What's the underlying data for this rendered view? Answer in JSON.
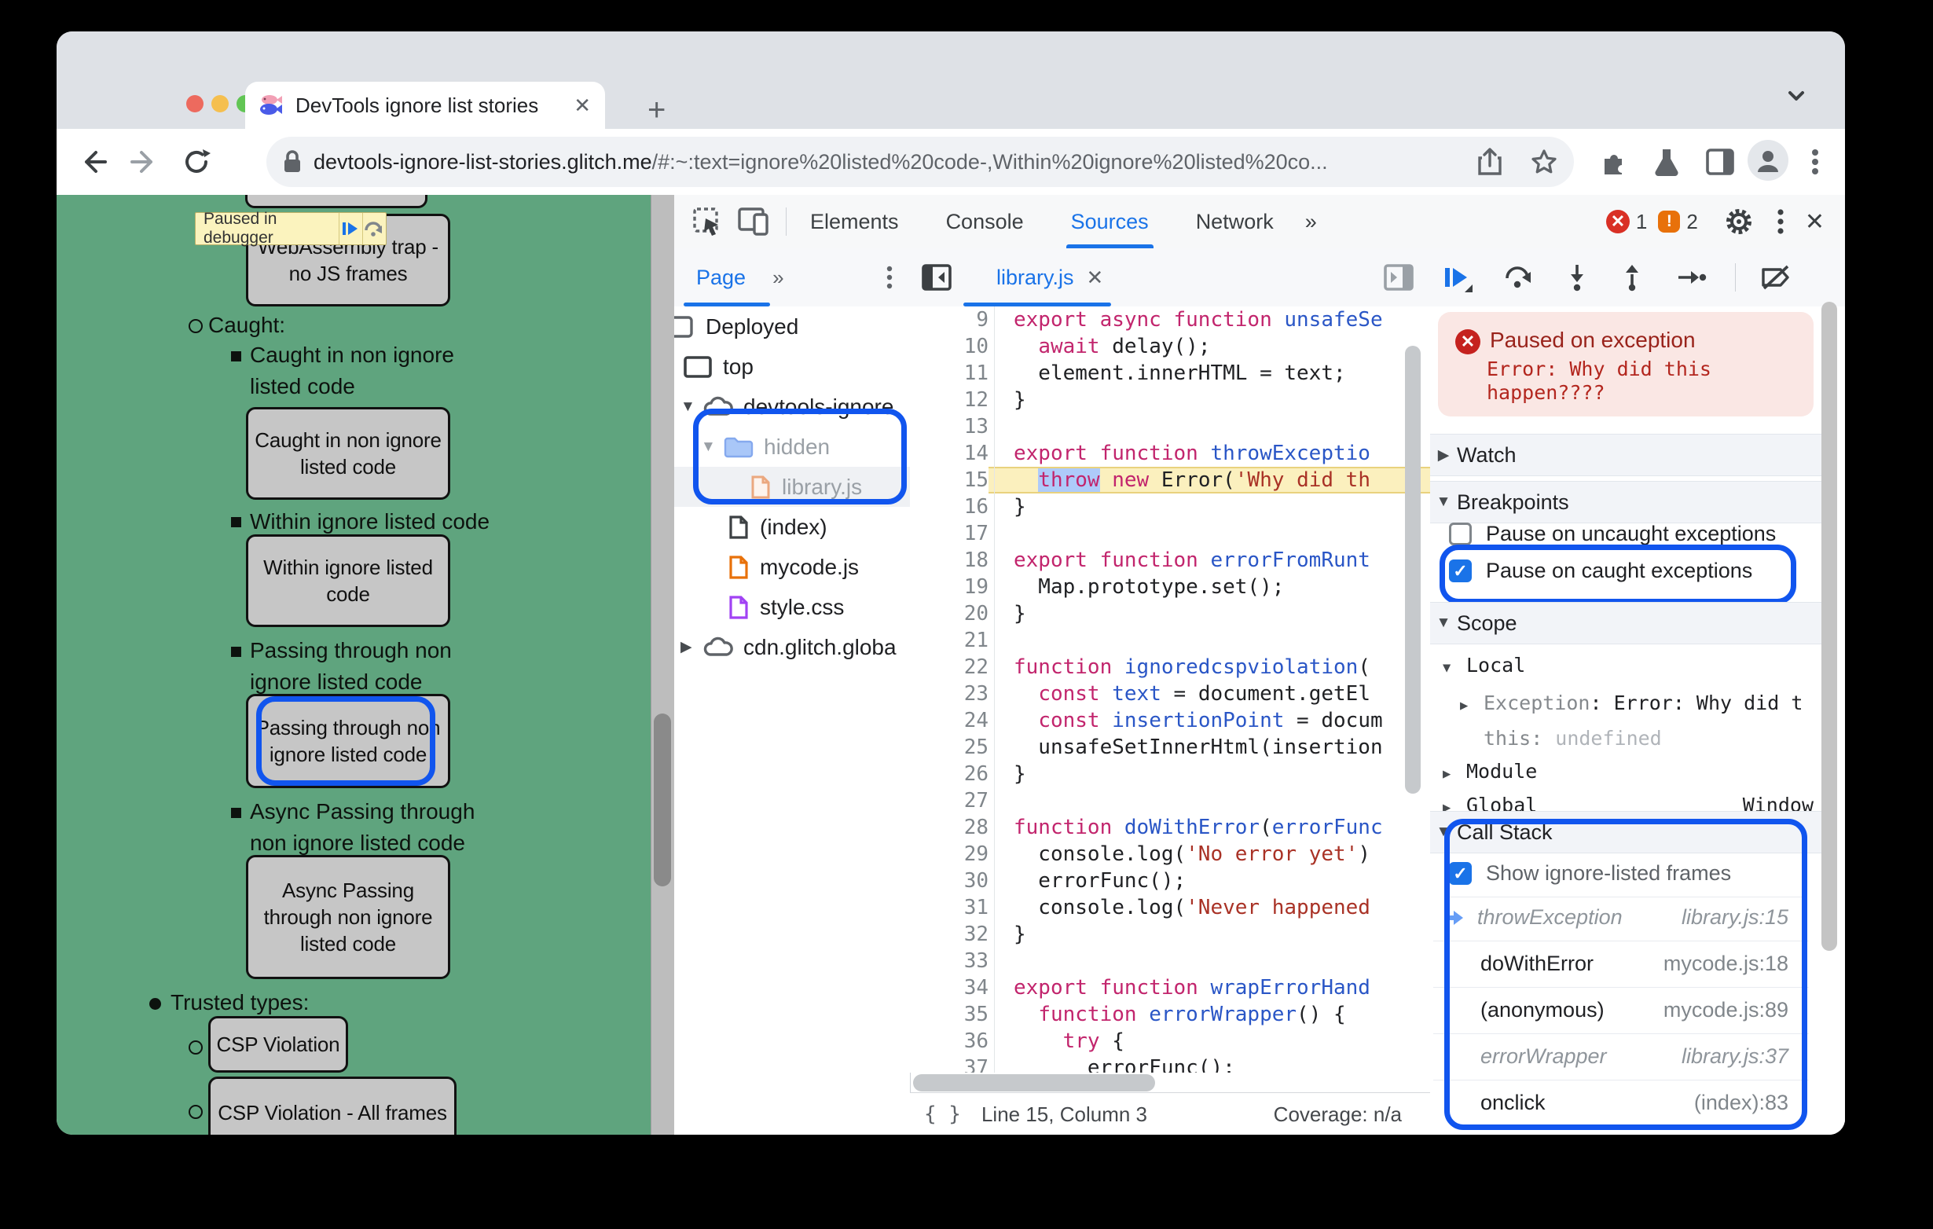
{
  "colors": {
    "accent": "#1A73E8",
    "annotation": "#1155EE",
    "page_green": "#5FA47E",
    "paused_line": "#FBF0BE",
    "error_red": "#C5221F"
  },
  "window": {
    "tab_title": "DevTools ignore list stories",
    "url_domain": "devtools-ignore-list-stories.glitch.me",
    "url_path": "/#:~:text=ignore%20listed%20code-,Within%20ignore%20listed%20co..."
  },
  "page": {
    "debugger_banner": "Paused in debugger",
    "wasm_button": "WebAssembly trap - no JS frames",
    "caught_label": "Caught:",
    "caught_item": "Caught in non ignore listed code",
    "caught_button": "Caught in non ignore listed code",
    "within_item": "Within ignore listed code",
    "within_button": "Within ignore listed code",
    "passing_item": "Passing through non ignore listed code",
    "passing_button": "Passing through non ignore listed code",
    "async_item": "Async Passing through non ignore listed code",
    "async_button": "Async Passing through non ignore listed code",
    "trusted_label": "Trusted types:",
    "csp_button": "CSP Violation",
    "csp_frames_button": "CSP Violation - All frames"
  },
  "devtools": {
    "tabs": {
      "elements": "Elements",
      "console": "Console",
      "sources": "Sources",
      "network": "Network",
      "more": "»"
    },
    "error_count": "1",
    "warning_count": "2",
    "navigator": {
      "tab_label": "Page",
      "more": "»",
      "tree": [
        {
          "label": "Deployed"
        },
        {
          "label": "top"
        },
        {
          "label": "devtools-ignore"
        },
        {
          "label": "hidden"
        },
        {
          "label": "library.js"
        },
        {
          "label": "(index)"
        },
        {
          "label": "mycode.js"
        },
        {
          "label": "style.css"
        },
        {
          "label": "cdn.glitch.globa"
        }
      ]
    },
    "editor": {
      "tab_label": "library.js",
      "status_line": "Line 15, Column 3",
      "status_coverage": "Coverage: n/a",
      "lines": [
        {
          "n": "9",
          "tokens": [
            [
              "k",
              "export async function "
            ],
            [
              "f",
              "unsafeSe"
            ]
          ]
        },
        {
          "n": "10",
          "tokens": [
            [
              "d",
              "  "
            ],
            [
              "k",
              "await"
            ],
            [
              "d",
              " delay();"
            ]
          ]
        },
        {
          "n": "11",
          "tokens": [
            [
              "d",
              "  element.innerHTML = text;"
            ]
          ]
        },
        {
          "n": "12",
          "tokens": [
            [
              "d",
              "}"
            ]
          ]
        },
        {
          "n": "13",
          "tokens": []
        },
        {
          "n": "14",
          "tokens": [
            [
              "k",
              "export function "
            ],
            [
              "f",
              "throwExceptio"
            ]
          ]
        },
        {
          "n": "15",
          "hl": true,
          "tokens": [
            [
              "d",
              "  "
            ],
            [
              "k sel",
              "throw"
            ],
            [
              "d",
              " "
            ],
            [
              "k",
              "new"
            ],
            [
              "d",
              " Error("
            ],
            [
              "s",
              "'Why did th"
            ]
          ]
        },
        {
          "n": "16",
          "tokens": [
            [
              "d",
              "}"
            ]
          ]
        },
        {
          "n": "17",
          "tokens": []
        },
        {
          "n": "18",
          "tokens": [
            [
              "k",
              "export function "
            ],
            [
              "f",
              "errorFromRunt"
            ]
          ]
        },
        {
          "n": "19",
          "tokens": [
            [
              "d",
              "  Map.prototype.set();"
            ]
          ]
        },
        {
          "n": "20",
          "tokens": [
            [
              "d",
              "}"
            ]
          ]
        },
        {
          "n": "21",
          "tokens": []
        },
        {
          "n": "22",
          "tokens": [
            [
              "k",
              "function "
            ],
            [
              "f",
              "ignoredcspviolation"
            ],
            [
              "d",
              "("
            ]
          ]
        },
        {
          "n": "23",
          "tokens": [
            [
              "d",
              "  "
            ],
            [
              "k",
              "const"
            ],
            [
              "d",
              " "
            ],
            [
              "f",
              "text"
            ],
            [
              "d",
              " = document.getEl"
            ]
          ]
        },
        {
          "n": "24",
          "tokens": [
            [
              "d",
              "  "
            ],
            [
              "k",
              "const"
            ],
            [
              "d",
              " "
            ],
            [
              "f",
              "insertionPoint"
            ],
            [
              "d",
              " = docum"
            ]
          ]
        },
        {
          "n": "25",
          "tokens": [
            [
              "d",
              "  unsafeSetInnerHtml(insertion"
            ]
          ]
        },
        {
          "n": "26",
          "tokens": [
            [
              "d",
              "}"
            ]
          ]
        },
        {
          "n": "27",
          "tokens": []
        },
        {
          "n": "28",
          "tokens": [
            [
              "k",
              "function "
            ],
            [
              "f",
              "doWithError"
            ],
            [
              "d",
              "("
            ],
            [
              "f",
              "errorFunc"
            ]
          ]
        },
        {
          "n": "29",
          "tokens": [
            [
              "d",
              "  console.log("
            ],
            [
              "s",
              "'No error yet'"
            ],
            [
              "d",
              ")"
            ]
          ]
        },
        {
          "n": "30",
          "tokens": [
            [
              "d",
              "  errorFunc();"
            ]
          ]
        },
        {
          "n": "31",
          "tokens": [
            [
              "d",
              "  console.log("
            ],
            [
              "s",
              "'Never happened"
            ]
          ]
        },
        {
          "n": "32",
          "tokens": [
            [
              "d",
              "}"
            ]
          ]
        },
        {
          "n": "33",
          "tokens": []
        },
        {
          "n": "34",
          "tokens": [
            [
              "k",
              "export function "
            ],
            [
              "f",
              "wrapErrorHand"
            ]
          ]
        },
        {
          "n": "35",
          "tokens": [
            [
              "d",
              "  "
            ],
            [
              "k",
              "function"
            ],
            [
              "d",
              " "
            ],
            [
              "f",
              "errorWrapper"
            ],
            [
              "d",
              "() {"
            ]
          ]
        },
        {
          "n": "36",
          "tokens": [
            [
              "d",
              "    "
            ],
            [
              "k",
              "try"
            ],
            [
              "d",
              " {"
            ]
          ]
        },
        {
          "n": "37",
          "tokens": [
            [
              "d",
              "      errorFunc();"
            ]
          ]
        }
      ]
    },
    "sidebar": {
      "paused": {
        "title": "Paused on exception",
        "message_line1": "Error: Why did this",
        "message_line2": "happen????"
      },
      "watch_label": "Watch",
      "breakpoints_label": "Breakpoints",
      "cb_uncaught": "Pause on uncaught exceptions",
      "cb_caught": "Pause on caught exceptions",
      "scope": {
        "title": "Scope",
        "local": "Local",
        "exception_key": "Exception",
        "exception_val": ": Error: Why did t",
        "this_key": "this:",
        "this_val": "undefined",
        "module": "Module",
        "global": "Global",
        "global_val": "Window"
      },
      "callstack": {
        "title": "Call Stack",
        "toggle": "Show ignore-listed frames",
        "frames": [
          {
            "name": "throwException",
            "location": "library.js:15"
          },
          {
            "name": "doWithError",
            "location": "mycode.js:18"
          },
          {
            "name": "(anonymous)",
            "location": "mycode.js:89"
          },
          {
            "name": "errorWrapper",
            "location": "library.js:37"
          },
          {
            "name": "onclick",
            "location": "(index):83"
          }
        ]
      }
    }
  }
}
